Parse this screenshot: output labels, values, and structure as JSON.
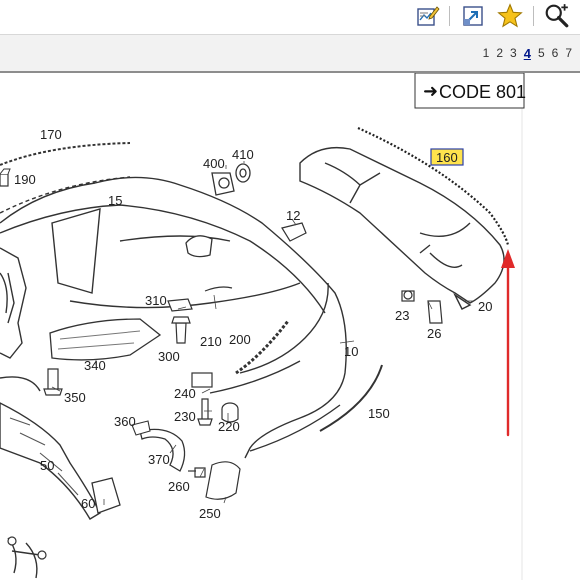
{
  "toolbar": {
    "icons": [
      "notes-edit-icon",
      "export-icon",
      "favorite-star-icon",
      "zoom-icon"
    ]
  },
  "pager": {
    "pages": [
      "1",
      "2",
      "3",
      "4",
      "5",
      "6",
      "7"
    ],
    "active_page": "4"
  },
  "diagram": {
    "code_box": "CODE 801",
    "highlight_label": "160",
    "highlight_color": "#ffe34d",
    "arrow_color": "#e02a2a",
    "part_labels": {
      "p170": "170",
      "p190": "190",
      "p15": "15",
      "p400": "400",
      "p410": "410",
      "p12": "12",
      "p160": "160",
      "p23": "23",
      "p26": "26",
      "p20": "20",
      "p310": "310",
      "p300": "300",
      "p210": "210",
      "p200": "200",
      "p10": "10",
      "p340": "340",
      "p350": "350",
      "p240": "240",
      "p230": "230",
      "p220": "220",
      "p150": "150",
      "p360": "360",
      "p370": "370",
      "p50": "50",
      "p260": "260",
      "p60": "60",
      "p250": "250"
    }
  }
}
